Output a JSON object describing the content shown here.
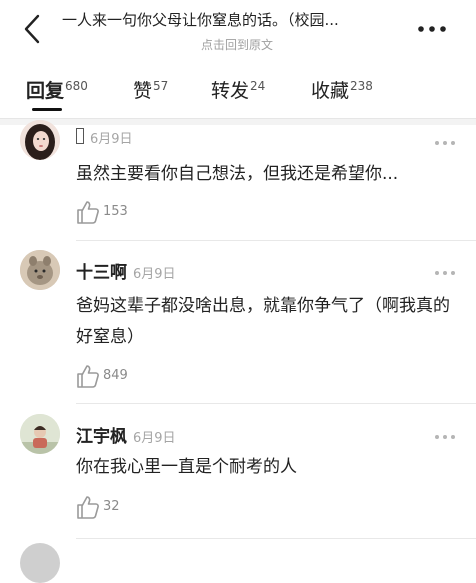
{
  "header": {
    "title": "一人来一句你父母让你窒息的话。（校园...",
    "subtitle": "点击回到原文",
    "back_icon": "chevron-left-icon",
    "more_icon": "more-dots-icon"
  },
  "tabs": [
    {
      "label": "回复",
      "count": "680",
      "active": true
    },
    {
      "label": "赞",
      "count": "57",
      "active": false
    },
    {
      "label": "转发",
      "count": "24",
      "active": false
    },
    {
      "label": "收藏",
      "count": "238",
      "active": false
    }
  ],
  "comments": [
    {
      "username": "",
      "date": "6月9日",
      "text": "虽然主要看你自己想法，但我还是希望你...",
      "likes": "153"
    },
    {
      "username": "十三啊",
      "date": "6月9日",
      "text": "爸妈这辈子都没啥出息，就靠你争气了（啊我真的好窒息）",
      "likes": "849"
    },
    {
      "username": "江宇枫",
      "date": "6月9日",
      "text": "你在我心里一直是个耐考的人",
      "likes": "32"
    }
  ],
  "colors": {
    "accent": "#111111",
    "muted": "#a5a5a5",
    "separator": "#e8e8e8"
  }
}
